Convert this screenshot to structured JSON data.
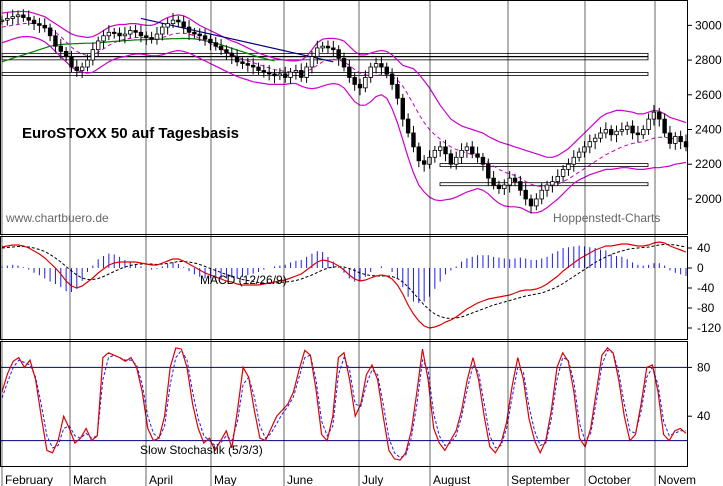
{
  "chart_data": {
    "type": "line",
    "title": "EuroSTOXX 50 auf Tagesbasis",
    "watermark_left": "www.chartbuero.de",
    "watermark_right": "Hoppenstedt-Charts",
    "months": [
      "February",
      "March",
      "April",
      "May",
      "June",
      "July",
      "August",
      "September",
      "October",
      "Novem"
    ],
    "colors": {
      "bollinger": "#cc00cc",
      "moving_average_short": "#cc00cc",
      "moving_average_long": "#008000",
      "trend_line": "#000080",
      "macd": "#e00000",
      "macd_signal": "#000000",
      "macd_histogram": "#1a1aff",
      "stochastic_k": "#e00000",
      "stochastic_d": "#1a1aff",
      "gridline": "#000000"
    },
    "price_panel": {
      "ylim": [
        1850,
        3100
      ],
      "yticks": [
        "3000",
        "2800",
        "2600",
        "2400",
        "2200",
        "2000"
      ],
      "support_resistance_levels": [
        2830,
        2810,
        2720,
        2195,
        2085
      ],
      "close": [
        3030,
        3040,
        3050,
        3060,
        3045,
        3030,
        3010,
        3000,
        2985,
        2940,
        2880,
        2850,
        2820,
        2760,
        2740,
        2760,
        2800,
        2860,
        2910,
        2940,
        2960,
        2955,
        2940,
        2950,
        2970,
        2960,
        2940,
        2930,
        2920,
        2950,
        2990,
        3010,
        3030,
        3020,
        2990,
        2960,
        2950,
        2940,
        2920,
        2900,
        2880,
        2860,
        2840,
        2820,
        2790,
        2780,
        2770,
        2760,
        2740,
        2730,
        2720,
        2710,
        2720,
        2700,
        2730,
        2740,
        2700,
        2760,
        2820,
        2870,
        2880,
        2870,
        2860,
        2810,
        2760,
        2700,
        2660,
        2640,
        2700,
        2760,
        2780,
        2760,
        2720,
        2660,
        2580,
        2460,
        2380,
        2300,
        2220,
        2200,
        2240,
        2280,
        2300,
        2260,
        2200,
        2240,
        2280,
        2300,
        2260,
        2240,
        2200,
        2120,
        2080,
        2060,
        2080,
        2120,
        2100,
        2050,
        2000,
        1960,
        2000,
        2050,
        2080,
        2100,
        2130,
        2170,
        2200,
        2240,
        2270,
        2300,
        2330,
        2350,
        2380,
        2400,
        2370,
        2390,
        2400,
        2420,
        2380,
        2370,
        2400,
        2460,
        2500,
        2460,
        2380,
        2320,
        2360,
        2330,
        2300
      ],
      "bollinger_upper": [
        3070,
        3075,
        3078,
        3080,
        3080,
        3078,
        3070,
        3060,
        3050,
        3030,
        3010,
        2990,
        2970,
        2950,
        2940,
        2935,
        2930,
        2935,
        2950,
        2970,
        2990,
        3000,
        3005,
        3005,
        3010,
        3010,
        3005,
        3000,
        3000,
        3010,
        3030,
        3045,
        3055,
        3060,
        3055,
        3040,
        3020,
        3000,
        2985,
        2970,
        2955,
        2940,
        2925,
        2910,
        2900,
        2885,
        2870,
        2855,
        2840,
        2830,
        2820,
        2810,
        2805,
        2800,
        2795,
        2795,
        2800,
        2820,
        2860,
        2900,
        2920,
        2925,
        2925,
        2920,
        2910,
        2880,
        2850,
        2830,
        2830,
        2840,
        2850,
        2855,
        2850,
        2830,
        2800,
        2770,
        2760,
        2750,
        2720,
        2680,
        2640,
        2590,
        2540,
        2500,
        2460,
        2440,
        2420,
        2410,
        2400,
        2390,
        2380,
        2360,
        2345,
        2330,
        2320,
        2310,
        2300,
        2290,
        2280,
        2270,
        2260,
        2250,
        2240,
        2240,
        2250,
        2270,
        2290,
        2320,
        2350,
        2380,
        2410,
        2440,
        2470,
        2490,
        2500,
        2510,
        2510,
        2505,
        2500,
        2490,
        2490,
        2500,
        2510,
        2505,
        2490,
        2470,
        2460,
        2450,
        2440
      ],
      "bollinger_lower": [
        2900,
        2910,
        2920,
        2930,
        2935,
        2935,
        2930,
        2920,
        2905,
        2880,
        2850,
        2820,
        2790,
        2760,
        2740,
        2730,
        2725,
        2730,
        2750,
        2770,
        2790,
        2805,
        2815,
        2820,
        2830,
        2835,
        2835,
        2830,
        2825,
        2825,
        2830,
        2840,
        2850,
        2855,
        2850,
        2840,
        2825,
        2810,
        2795,
        2780,
        2765,
        2750,
        2735,
        2720,
        2705,
        2695,
        2685,
        2675,
        2670,
        2665,
        2660,
        2660,
        2660,
        2660,
        2665,
        2665,
        2650,
        2640,
        2635,
        2640,
        2650,
        2660,
        2665,
        2660,
        2640,
        2600,
        2560,
        2540,
        2540,
        2560,
        2590,
        2600,
        2580,
        2520,
        2440,
        2340,
        2240,
        2150,
        2080,
        2040,
        2010,
        1995,
        1990,
        1995,
        2000,
        2010,
        2025,
        2040,
        2050,
        2060,
        2050,
        2030,
        2000,
        1975,
        1960,
        1955,
        1955,
        1950,
        1935,
        1920,
        1920,
        1930,
        1950,
        1975,
        2000,
        2030,
        2060,
        2090,
        2110,
        2125,
        2140,
        2150,
        2160,
        2170,
        2170,
        2175,
        2180,
        2180,
        2175,
        2170,
        2170,
        2175,
        2180,
        2180,
        2185,
        2190,
        2200,
        2205,
        2210
      ],
      "moving_average_short": [
        2990,
        2995,
        3000,
        3005,
        3010,
        3012,
        3010,
        3005,
        2995,
        2980,
        2960,
        2935,
        2905,
        2875,
        2850,
        2835,
        2825,
        2830,
        2845,
        2865,
        2885,
        2900,
        2912,
        2920,
        2925,
        2930,
        2930,
        2928,
        2925,
        2925,
        2930,
        2940,
        2950,
        2955,
        2955,
        2950,
        2940,
        2925,
        2910,
        2895,
        2880,
        2865,
        2850,
        2835,
        2820,
        2805,
        2795,
        2785,
        2775,
        2765,
        2755,
        2745,
        2740,
        2735,
        2732,
        2730,
        2730,
        2735,
        2750,
        2770,
        2790,
        2800,
        2805,
        2800,
        2790,
        2770,
        2745,
        2725,
        2715,
        2710,
        2712,
        2715,
        2715,
        2705,
        2685,
        2650,
        2600,
        2545,
        2490,
        2440,
        2400,
        2370,
        2345,
        2320,
        2300,
        2285,
        2275,
        2265,
        2255,
        2245,
        2230,
        2210,
        2190,
        2170,
        2155,
        2145,
        2135,
        2120,
        2100,
        2085,
        2075,
        2070,
        2070,
        2075,
        2085,
        2100,
        2115,
        2135,
        2155,
        2175,
        2195,
        2215,
        2235,
        2255,
        2270,
        2285,
        2300,
        2310,
        2320,
        2325,
        2330,
        2340,
        2350,
        2355,
        2355,
        2350,
        2345,
        2340,
        2335
      ],
      "moving_average_long": [
        2790,
        2800,
        2810,
        2820,
        2830,
        2840,
        2850,
        2860,
        2870,
        2880,
        2885,
        2890,
        2892,
        2894,
        2895,
        2896,
        2897,
        2898,
        2900,
        2902,
        2905,
        2908,
        2910,
        2912,
        2914,
        2916,
        2917,
        2918,
        2919,
        2920,
        2921,
        2922,
        2923,
        2924,
        2925,
        2924,
        2922,
        2918,
        2912,
        2905,
        2897,
        2888,
        2878,
        2868,
        2858,
        2848,
        2838,
        2828,
        2818,
        2810,
        2802,
        2795
      ],
      "trend_line": [
        [
          118,
          1
        ],
        [
          140,
          4
        ],
        [
          0,
          2860
        ],
        [
          25,
          2845
        ]
      ]
    },
    "macd_panel": {
      "label": "MACD (12/26/9)",
      "ylim": [
        -140,
        60
      ],
      "yticks": [
        "40",
        "0",
        "-40",
        "-80",
        "-120"
      ],
      "macd": [
        42,
        44,
        46,
        46,
        44,
        40,
        34,
        28,
        20,
        10,
        0,
        -12,
        -26,
        -36,
        -40,
        -36,
        -28,
        -20,
        -10,
        -2,
        6,
        10,
        12,
        12,
        12,
        12,
        10,
        8,
        6,
        6,
        10,
        14,
        18,
        18,
        14,
        8,
        2,
        -4,
        -10,
        -14,
        -18,
        -22,
        -26,
        -28,
        -32,
        -34,
        -34,
        -34,
        -34,
        -32,
        -30,
        -28,
        -26,
        -24,
        -20,
        -16,
        -12,
        -4,
        4,
        12,
        16,
        14,
        10,
        4,
        -4,
        -14,
        -22,
        -26,
        -24,
        -20,
        -16,
        -14,
        -16,
        -22,
        -34,
        -52,
        -74,
        -92,
        -106,
        -116,
        -120,
        -118,
        -114,
        -108,
        -104,
        -98,
        -90,
        -82,
        -76,
        -70,
        -66,
        -62,
        -60,
        -58,
        -56,
        -54,
        -50,
        -46,
        -44,
        -44,
        -42,
        -38,
        -32,
        -24,
        -16,
        -6,
        2,
        10,
        18,
        24,
        30,
        36,
        40,
        44,
        44,
        46,
        48,
        48,
        46,
        44,
        44,
        46,
        50,
        52,
        50,
        44,
        40,
        36,
        32
      ],
      "signal": [
        40,
        41,
        42,
        43,
        43,
        42,
        40,
        37,
        33,
        27,
        20,
        12,
        3,
        -6,
        -14,
        -20,
        -23,
        -23,
        -21,
        -17,
        -12,
        -7,
        -2,
        2,
        5,
        7,
        8,
        8,
        8,
        7,
        8,
        9,
        11,
        13,
        13,
        12,
        10,
        7,
        3,
        -1,
        -5,
        -9,
        -13,
        -16,
        -20,
        -23,
        -25,
        -27,
        -29,
        -30,
        -30,
        -30,
        -29,
        -28,
        -27,
        -25,
        -22,
        -18,
        -14,
        -9,
        -4,
        0,
        2,
        3,
        2,
        -1,
        -5,
        -10,
        -13,
        -15,
        -16,
        -16,
        -16,
        -17,
        -21,
        -28,
        -38,
        -50,
        -62,
        -74,
        -84,
        -92,
        -97,
        -100,
        -101,
        -100,
        -98,
        -94,
        -90,
        -86,
        -82,
        -78,
        -74,
        -71,
        -68,
        -65,
        -62,
        -59,
        -56,
        -54,
        -52,
        -50,
        -46,
        -42,
        -37,
        -31,
        -24,
        -17,
        -10,
        -3,
        4,
        11,
        17,
        22,
        27,
        31,
        34,
        37,
        39,
        40,
        41,
        42,
        44,
        46,
        47,
        47,
        46,
        44,
        42
      ]
    },
    "stochastic_panel": {
      "label": "Slow Stochastik (5/3/3)",
      "ylim": [
        0,
        100
      ],
      "yticks": [
        "80",
        "40"
      ],
      "reference_levels": [
        80,
        20
      ],
      "k": [
        60,
        75,
        85,
        88,
        80,
        86,
        70,
        40,
        12,
        10,
        20,
        40,
        30,
        18,
        22,
        30,
        20,
        24,
        88,
        92,
        90,
        88,
        85,
        88,
        80,
        60,
        30,
        20,
        22,
        40,
        80,
        96,
        95,
        80,
        50,
        30,
        18,
        22,
        12,
        20,
        28,
        14,
        45,
        80,
        72,
        45,
        22,
        20,
        30,
        40,
        45,
        50,
        60,
        78,
        94,
        90,
        62,
        25,
        20,
        40,
        88,
        92,
        70,
        40,
        50,
        74,
        82,
        70,
        40,
        12,
        5,
        4,
        10,
        28,
        60,
        95,
        70,
        30,
        18,
        12,
        20,
        28,
        45,
        70,
        88,
        70,
        40,
        15,
        10,
        18,
        35,
        65,
        88,
        70,
        38,
        20,
        10,
        20,
        45,
        80,
        92,
        85,
        60,
        22,
        15,
        30,
        60,
        90,
        96,
        92,
        70,
        40,
        20,
        25,
        50,
        80,
        82,
        60,
        25,
        20,
        28,
        30,
        26
      ],
      "d": [
        55,
        68,
        80,
        86,
        84,
        82,
        72,
        50,
        24,
        14,
        16,
        30,
        32,
        24,
        22,
        26,
        22,
        24,
        70,
        88,
        90,
        88,
        86,
        86,
        82,
        66,
        40,
        26,
        22,
        32,
        66,
        88,
        94,
        86,
        60,
        38,
        24,
        20,
        16,
        18,
        24,
        20,
        36,
        66,
        72,
        56,
        32,
        22,
        26,
        34,
        42,
        48,
        56,
        72,
        88,
        90,
        70,
        36,
        24,
        32,
        74,
        88,
        78,
        50,
        48,
        66,
        78,
        74,
        50,
        22,
        10,
        6,
        8,
        22,
        50,
        86,
        78,
        42,
        24,
        16,
        18,
        24,
        40,
        62,
        82,
        76,
        50,
        24,
        14,
        16,
        30,
        56,
        80,
        76,
        48,
        28,
        16,
        18,
        38,
        70,
        88,
        86,
        68,
        34,
        20,
        26,
        52,
        82,
        94,
        92,
        76,
        50,
        28,
        26,
        44,
        72,
        80,
        66,
        36,
        24,
        26,
        28,
        28
      ]
    }
  }
}
